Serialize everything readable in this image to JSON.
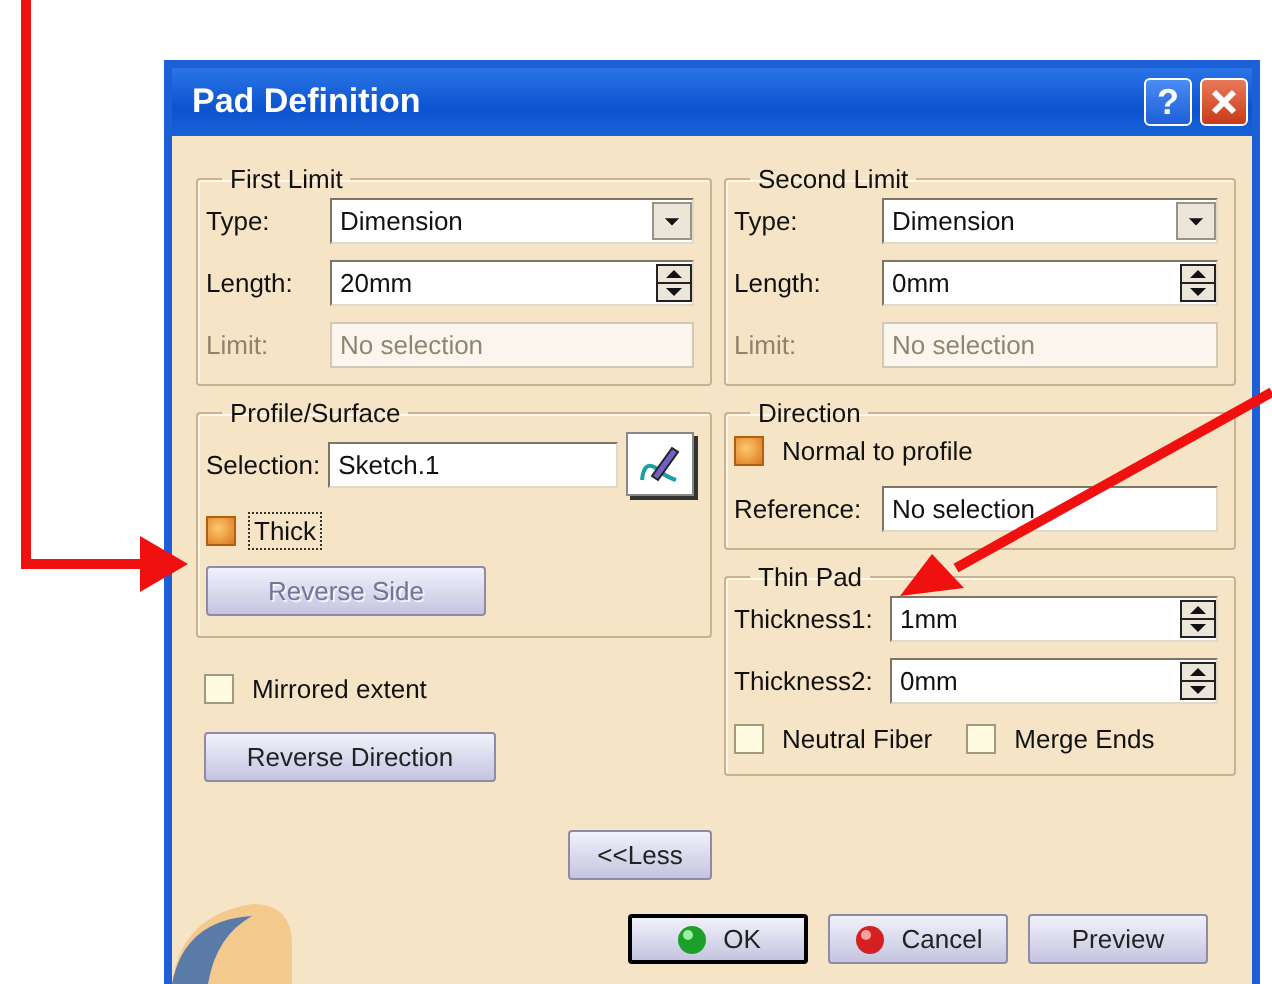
{
  "window": {
    "title": "Pad Definition",
    "help": "?"
  },
  "first_limit": {
    "title": "First Limit",
    "fields": [
      {
        "kind": "combo",
        "label": "Type:",
        "value": "Dimension",
        "disabled": false
      },
      {
        "kind": "spin",
        "label": "Length:",
        "value": "20mm",
        "disabled": false
      },
      {
        "kind": "text",
        "label": "Limit:",
        "value": "No selection",
        "disabled": true
      }
    ]
  },
  "profile": {
    "title": "Profile/Surface",
    "selection_label": "Selection:",
    "selection_value": "Sketch.1",
    "thick": {
      "label": "Thick",
      "checked": true,
      "focused": true
    },
    "reverse_side": {
      "label": "Reverse Side",
      "disabled": true
    }
  },
  "mirrored": {
    "label": "Mirrored extent",
    "checked": false
  },
  "reverse_direction": {
    "label": "Reverse Direction",
    "disabled": false
  },
  "less": {
    "label": "<<Less",
    "disabled": false
  },
  "second_limit": {
    "title": "Second Limit",
    "fields": [
      {
        "kind": "combo",
        "label": "Type:",
        "value": "Dimension",
        "disabled": false
      },
      {
        "kind": "spin",
        "label": "Length:",
        "value": "0mm",
        "disabled": false
      },
      {
        "kind": "text",
        "label": "Limit:",
        "value": "No selection",
        "disabled": true
      }
    ]
  },
  "direction": {
    "title": "Direction",
    "normal": {
      "label": "Normal to profile",
      "checked": true
    },
    "fields": [
      {
        "kind": "text",
        "label": "Reference:",
        "value": "No selection",
        "disabled": false
      }
    ]
  },
  "thin_pad": {
    "title": "Thin Pad",
    "fields": [
      {
        "kind": "spin",
        "label": "Thickness1:",
        "value": "1mm",
        "disabled": false
      },
      {
        "kind": "spin",
        "label": "Thickness2:",
        "value": "0mm",
        "disabled": false
      }
    ],
    "checks": [
      {
        "label": "Neutral Fiber",
        "checked": false
      },
      {
        "label": "Merge Ends",
        "checked": false
      }
    ]
  },
  "footer": [
    {
      "kind": "ok",
      "label": "OK",
      "default": true
    },
    {
      "kind": "cancel",
      "label": "Cancel",
      "default": false
    },
    {
      "kind": "plain",
      "label": "Preview",
      "default": false
    }
  ]
}
